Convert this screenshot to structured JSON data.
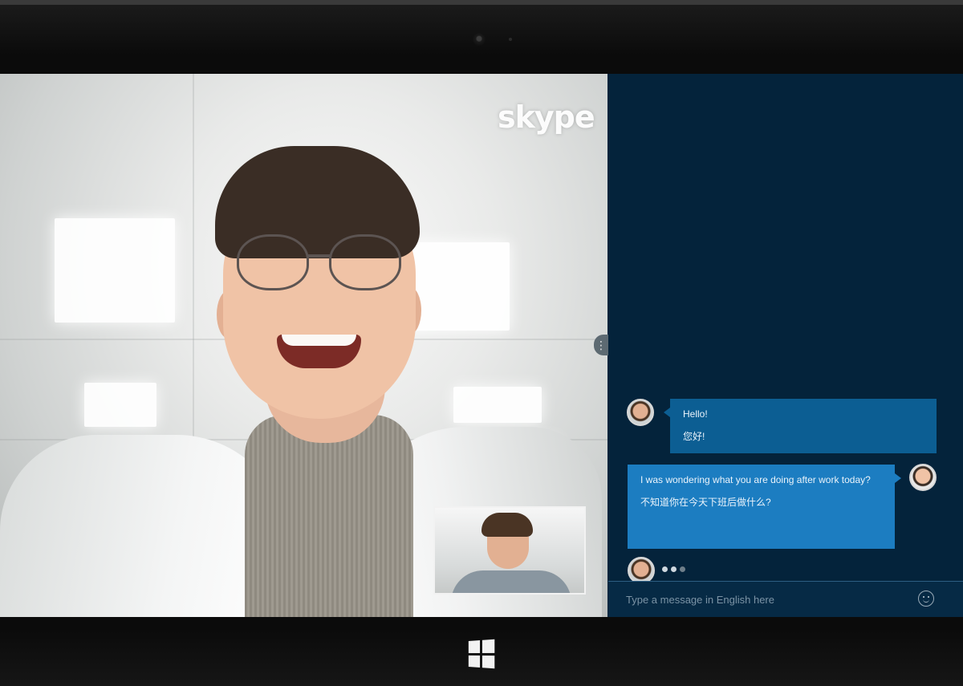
{
  "app": {
    "name": "Skype",
    "logo_text": "skype"
  },
  "call": {
    "remote_participant_name": "",
    "self_view_label": ""
  },
  "chat": {
    "messages": [
      {
        "side": "incoming",
        "text": "Hello!",
        "translation": "您好!"
      },
      {
        "side": "outgoing",
        "text": "I was wondering what you are doing after work today?",
        "translation": "不知道你在今天下班后做什么?"
      }
    ],
    "typing_indicator": true
  },
  "composer": {
    "placeholder": "Type a message in English here"
  },
  "colors": {
    "chat_background": "#04233b",
    "incoming_bubble": "#0c5e93",
    "outgoing_bubble": "#1c7dc1"
  },
  "icons": {
    "emoji": "emoji-icon",
    "windows": "windows-logo-icon",
    "panel_handle": "more-vertical-icon"
  }
}
